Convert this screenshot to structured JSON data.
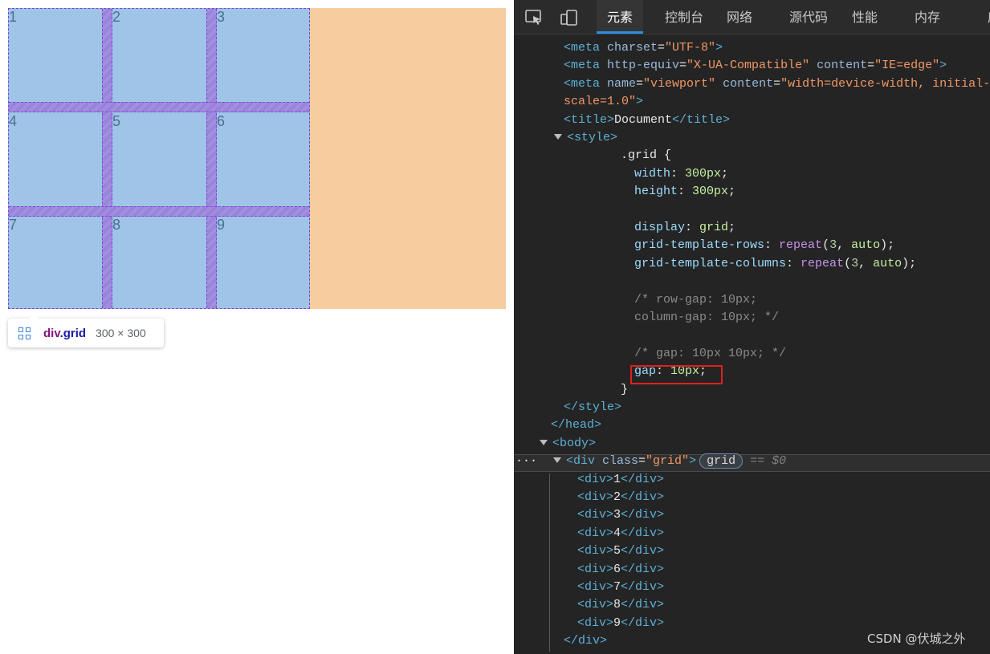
{
  "rendered_page": {
    "cells": [
      "1",
      "2",
      "3",
      "4",
      "5",
      "6",
      "7",
      "8",
      "9"
    ],
    "tooltip": {
      "tag": "div",
      "class": ".grid",
      "size": "300 × 300"
    }
  },
  "devtools": {
    "tabs": [
      "元素",
      "控制台",
      "网络",
      "源代码",
      "性能",
      "内存",
      "应用"
    ],
    "active_tab": "元素",
    "lines": [
      {
        "indent": 702,
        "parts": [
          [
            "tag",
            "<meta "
          ],
          [
            "attr",
            "charset"
          ],
          [
            "txt",
            "="
          ],
          [
            "val",
            "\"UTF-8\""
          ],
          [
            "tag",
            ">"
          ]
        ]
      },
      {
        "indent": 702,
        "parts": [
          [
            "tag",
            "<meta "
          ],
          [
            "attr",
            "http-equiv"
          ],
          [
            "txt",
            "="
          ],
          [
            "val",
            "\"X-UA-Compatible\""
          ],
          [
            "txt",
            " "
          ],
          [
            "attr",
            "content"
          ],
          [
            "txt",
            "="
          ],
          [
            "val",
            "\"IE=edge\""
          ],
          [
            "tag",
            ">"
          ]
        ]
      },
      {
        "indent": 702,
        "parts": [
          [
            "tag",
            "<meta "
          ],
          [
            "attr",
            "name"
          ],
          [
            "txt",
            "="
          ],
          [
            "val",
            "\"viewport\""
          ],
          [
            "txt",
            " "
          ],
          [
            "attr",
            "content"
          ],
          [
            "txt",
            "="
          ],
          [
            "val",
            "\"width=device-width, initial-"
          ]
        ]
      },
      {
        "indent": 702,
        "parts": [
          [
            "val",
            "scale=1.0\""
          ],
          [
            "tag",
            ">"
          ]
        ]
      },
      {
        "indent": 702,
        "parts": [
          [
            "tag",
            "<title>"
          ],
          [
            "txt",
            "Document"
          ],
          [
            "tag",
            "</title>"
          ]
        ]
      },
      {
        "indent": 690,
        "caret": true,
        "parts": [
          [
            "tag",
            "<style>"
          ]
        ]
      },
      {
        "indent": 773,
        "parts": [
          [
            "txt",
            ".grid {"
          ]
        ]
      },
      {
        "indent": 790,
        "parts": [
          [
            "prop",
            "width"
          ],
          [
            "txt",
            ": "
          ],
          [
            "cval",
            "300px"
          ],
          [
            "txt",
            ";"
          ]
        ]
      },
      {
        "indent": 790,
        "parts": [
          [
            "prop",
            "height"
          ],
          [
            "txt",
            ": "
          ],
          [
            "cval",
            "300px"
          ],
          [
            "txt",
            ";"
          ]
        ]
      },
      {
        "indent": 790,
        "parts": []
      },
      {
        "indent": 790,
        "parts": [
          [
            "prop",
            "display"
          ],
          [
            "txt",
            ": "
          ],
          [
            "cval",
            "grid"
          ],
          [
            "txt",
            ";"
          ]
        ]
      },
      {
        "indent": 790,
        "parts": [
          [
            "prop",
            "grid-template-rows"
          ],
          [
            "txt",
            ": "
          ],
          [
            "fn",
            "repeat"
          ],
          [
            "txt",
            "("
          ],
          [
            "num",
            "3"
          ],
          [
            "txt",
            ", "
          ],
          [
            "cval",
            "auto"
          ],
          [
            "txt",
            ");"
          ]
        ]
      },
      {
        "indent": 790,
        "parts": [
          [
            "prop",
            "grid-template-columns"
          ],
          [
            "txt",
            ": "
          ],
          [
            "fn",
            "repeat"
          ],
          [
            "txt",
            "("
          ],
          [
            "num",
            "3"
          ],
          [
            "txt",
            ", "
          ],
          [
            "cval",
            "auto"
          ],
          [
            "txt",
            ");"
          ]
        ]
      },
      {
        "indent": 790,
        "parts": []
      },
      {
        "indent": 790,
        "parts": [
          [
            "cmt",
            "/* row-gap: 10px;"
          ]
        ]
      },
      {
        "indent": 790,
        "parts": [
          [
            "cmt",
            "column-gap: 10px; */"
          ]
        ]
      },
      {
        "indent": 790,
        "parts": []
      },
      {
        "indent": 790,
        "parts": [
          [
            "cmt",
            "/* gap: 10px 10px; */"
          ]
        ]
      },
      {
        "indent": 790,
        "parts": [
          [
            "prop",
            "gap"
          ],
          [
            "txt",
            ": "
          ],
          [
            "cval",
            "10px"
          ],
          [
            "txt",
            ";"
          ]
        ]
      },
      {
        "indent": 773,
        "parts": [
          [
            "txt",
            "}"
          ]
        ]
      },
      {
        "indent": 702,
        "parts": [
          [
            "tag",
            "</style>"
          ]
        ]
      },
      {
        "indent": 686,
        "parts": [
          [
            "tag",
            "</head>"
          ]
        ]
      },
      {
        "indent": 672,
        "caret": true,
        "parts": [
          [
            "tag",
            "<body>"
          ]
        ]
      },
      {
        "indent": 689,
        "caret": true,
        "selected": true,
        "parts": [
          [
            "tag",
            "<div "
          ],
          [
            "attr",
            "class"
          ],
          [
            "txt",
            "="
          ],
          [
            "val",
            "\"grid\""
          ],
          [
            "tag",
            ">"
          ]
        ]
      },
      {
        "indent": 719,
        "parts": [
          [
            "tag",
            "<div>"
          ],
          [
            "txt",
            "1"
          ],
          [
            "tag",
            "</div>"
          ]
        ]
      },
      {
        "indent": 719,
        "parts": [
          [
            "tag",
            "<div>"
          ],
          [
            "txt",
            "2"
          ],
          [
            "tag",
            "</div>"
          ]
        ]
      },
      {
        "indent": 719,
        "parts": [
          [
            "tag",
            "<div>"
          ],
          [
            "txt",
            "3"
          ],
          [
            "tag",
            "</div>"
          ]
        ]
      },
      {
        "indent": 719,
        "parts": [
          [
            "tag",
            "<div>"
          ],
          [
            "txt",
            "4"
          ],
          [
            "tag",
            "</div>"
          ]
        ]
      },
      {
        "indent": 719,
        "parts": [
          [
            "tag",
            "<div>"
          ],
          [
            "txt",
            "5"
          ],
          [
            "tag",
            "</div>"
          ]
        ]
      },
      {
        "indent": 719,
        "parts": [
          [
            "tag",
            "<div>"
          ],
          [
            "txt",
            "6"
          ],
          [
            "tag",
            "</div>"
          ]
        ]
      },
      {
        "indent": 719,
        "parts": [
          [
            "tag",
            "<div>"
          ],
          [
            "txt",
            "7"
          ],
          [
            "tag",
            "</div>"
          ]
        ]
      },
      {
        "indent": 719,
        "parts": [
          [
            "tag",
            "<div>"
          ],
          [
            "txt",
            "8"
          ],
          [
            "tag",
            "</div>"
          ]
        ]
      },
      {
        "indent": 719,
        "parts": [
          [
            "tag",
            "<div>"
          ],
          [
            "txt",
            "9"
          ],
          [
            "tag",
            "</div>"
          ]
        ]
      },
      {
        "indent": 702,
        "parts": [
          [
            "tag",
            "</div>"
          ]
        ]
      }
    ],
    "selected_badge": "grid",
    "selected_suffix": "== $0",
    "ellipsis": "···"
  },
  "watermark": "CSDN @伏城之外"
}
